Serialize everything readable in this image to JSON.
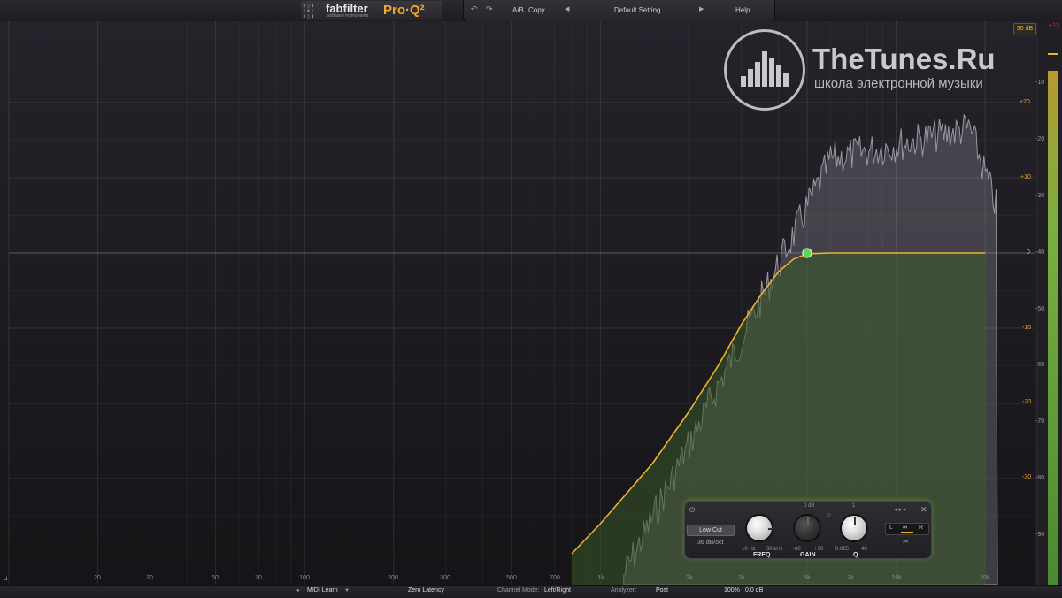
{
  "header": {
    "brand": "fabfilter",
    "brand_sub": "software instruments",
    "product": "Pro·Q²",
    "ab_label": "A/B",
    "copy_label": "Copy",
    "preset_name": "Default Setting",
    "help_label": "Help"
  },
  "display": {
    "range_button": "30 dB",
    "clip_label": "+13",
    "freq_labels": [
      "20",
      "30",
      "50",
      "70",
      "100",
      "200",
      "300",
      "500",
      "700",
      "1k",
      "2k",
      "3k",
      "5k",
      "7k",
      "10k",
      "20k"
    ],
    "gain_labels": [
      "+20",
      "+10",
      "0",
      "-10",
      "-20",
      "-30"
    ],
    "analyzer_labels": [
      "-10",
      "-20",
      "-30",
      "-40",
      "-50",
      "-60",
      "-70",
      "-80",
      "-90"
    ]
  },
  "watermark": {
    "title": "TheTunes.Ru",
    "subtitle": "школа электронной музыки"
  },
  "band_panel": {
    "shape": "Low Cut",
    "slope": "36 dB/oct",
    "freq_label": "FREQ",
    "freq_min": "10 Hz",
    "freq_max": "30 kHz",
    "gain_label": "GAIN",
    "gain_top": "0 dB",
    "gain_min": "-30",
    "gain_max": "+30",
    "q_label": "Q",
    "q_top": "1",
    "q_min": "0.025",
    "q_max": "40",
    "left": "L",
    "right": "R",
    "link_icon": "∞"
  },
  "footer": {
    "midi_learn": "MIDI Learn",
    "latency": "Zero Latency",
    "channel_mode_label": "Channel Mode:",
    "channel_mode_value": "Left/Right",
    "analyzer_label": "Analyzer:",
    "analyzer_value": "Post",
    "zoom": "100%",
    "output_gain": "0.0 dB"
  },
  "chart_data": {
    "type": "line",
    "x_scale": "log",
    "xlim": [
      10,
      30000
    ],
    "ylim": [
      -30,
      30
    ],
    "series": [
      {
        "x": [
          800,
          1000,
          1500,
          2000,
          2500,
          3000,
          3500,
          4000,
          4500,
          5000,
          6000,
          8000,
          12000,
          20000
        ],
        "values": [
          -40,
          -36,
          -28,
          -21,
          -15,
          -9.5,
          -5.5,
          -2.5,
          -0.8,
          -0.1,
          0,
          0,
          0,
          0
        ]
      }
    ],
    "band_node": {
      "x": 5000,
      "y": 0
    }
  },
  "colors": {
    "accent": "#f0b030",
    "node": "#5fd64f",
    "fill": "#3a5a2a"
  }
}
